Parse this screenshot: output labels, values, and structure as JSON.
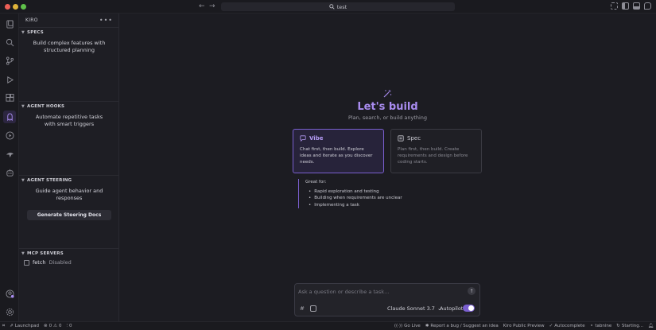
{
  "window": {
    "search_text": "test"
  },
  "activity_bar": {
    "items": [
      "explorer-icon",
      "search-icon",
      "source-control-icon",
      "run-debug-icon",
      "extensions-icon",
      "kiro-icon",
      "play-icon",
      "kiro-logo-icon",
      "robot-icon"
    ],
    "bottom": [
      "account-icon",
      "settings-gear-icon"
    ]
  },
  "sidebar": {
    "title": "KIRO",
    "specs": {
      "title": "SPECS",
      "description": "Build complex features with structured planning"
    },
    "hooks": {
      "title": "AGENT HOOKS",
      "description": "Automate repetitive tasks with smart triggers"
    },
    "steering": {
      "title": "AGENT STEERING",
      "description": "Guide agent behavior and responses",
      "button": "Generate Steering Docs"
    },
    "mcp": {
      "title": "MCP SERVERS",
      "servers": [
        {
          "name": "fetch",
          "status": "Disabled"
        }
      ]
    }
  },
  "main": {
    "headline": "Let's build",
    "subline": "Plan, search, or build anything",
    "vibe": {
      "title": "Vibe",
      "body": "Chat first, then build. Explore ideas and iterate as you discover needs."
    },
    "spec": {
      "title": "Spec",
      "body": "Plan first, then build. Create requirements and design before coding starts."
    },
    "great_for": {
      "title": "Great for:",
      "items": [
        "Rapid exploration and testing",
        "Building when requirements are unclear",
        "Implementing a task"
      ]
    },
    "chat": {
      "placeholder": "Ask a question or describe a task...",
      "hash": "#",
      "model": "Claude Sonnet 3.7",
      "autopilot_label": "Autopilot",
      "autopilot_on": true
    }
  },
  "statusbar": {
    "launchpad": "Launchpad",
    "errors": "0",
    "warnings": "0",
    "ports": "0",
    "go_live": "Go Live",
    "report": "Report a bug / Suggest an idea",
    "preview": "Kiro Public Preview",
    "autocomplete": "Autocomplete",
    "tabnine": "tabnine",
    "starting": "Starting..."
  },
  "colors": {
    "accent": "#a98cf0",
    "accent_border": "#7a5fcf",
    "background": "#1c1c22"
  }
}
